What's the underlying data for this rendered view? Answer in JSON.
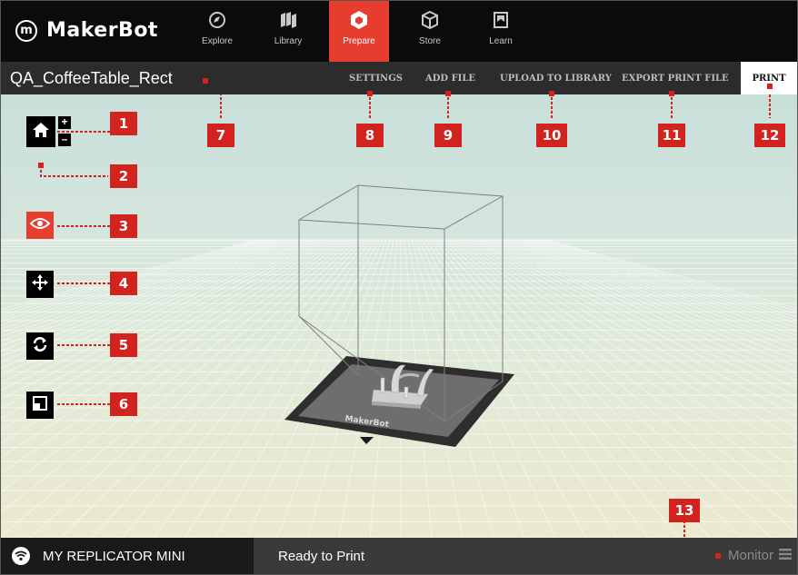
{
  "app": {
    "brand": "MakerBot",
    "brand_mark": "m"
  },
  "nav": {
    "tabs": [
      {
        "label": "Explore",
        "icon": "compass-icon"
      },
      {
        "label": "Library",
        "icon": "library-icon"
      },
      {
        "label": "Prepare",
        "icon": "prepare-cube-icon",
        "active": true
      },
      {
        "label": "Store",
        "icon": "box-icon"
      },
      {
        "label": "Learn",
        "icon": "book-icon"
      }
    ]
  },
  "titlebar": {
    "filename": "QA_CoffeeTable_Rect",
    "actions": [
      "SETTINGS",
      "ADD FILE",
      "UPLOAD TO LIBRARY",
      "EXPORT PRINT FILE"
    ],
    "print": "PRINT"
  },
  "tools": {
    "home": "home-icon",
    "zoom_in": "+",
    "zoom_out": "–",
    "view": "eye-icon",
    "move": "move-arrows-icon",
    "rotate": "rotate-icon",
    "scale": "scale-icon"
  },
  "callouts": [
    "1",
    "2",
    "3",
    "4",
    "5",
    "6",
    "7",
    "8",
    "9",
    "10",
    "11",
    "12",
    "13"
  ],
  "buildplate": {
    "label": "MakerBot"
  },
  "bottombar": {
    "printer_name": "MY REPLICATOR MINI",
    "status": "Ready to Print",
    "monitor": "Monitor"
  },
  "colors": {
    "accent": "#e63d2f",
    "callout": "#d2231e",
    "nav_bg": "#0b0b0b",
    "titlebar_bg": "#2c2c2c"
  }
}
